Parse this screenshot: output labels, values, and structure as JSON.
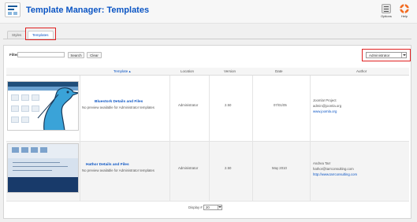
{
  "header": {
    "title": "Template Manager: Templates",
    "toolbar": [
      {
        "label": "Options",
        "icon": "options-icon"
      },
      {
        "label": "Help",
        "icon": "help-icon"
      }
    ]
  },
  "tabs": [
    {
      "label": "Styles",
      "active": false
    },
    {
      "label": "Templates",
      "active": true
    }
  ],
  "filter": {
    "label": "Filter:",
    "value": "",
    "search_label": "Search",
    "clear_label": "Clear",
    "client_select": "Administrator"
  },
  "table": {
    "columns": [
      "Template",
      "Location",
      "Version",
      "Date",
      "Author"
    ],
    "rows": [
      {
        "name": "Bluestork Details and Files",
        "desc": "No preview available for Administrator templates",
        "location": "Administrator",
        "version": "2.50",
        "date": "07/01/05",
        "author_name": "Joomla! Project",
        "author_email": "admin@joomla.org",
        "author_url": "www.joomla.org"
      },
      {
        "name": "Hathor Details and Files",
        "desc": "No preview available for Administrator templates",
        "location": "Administrator",
        "version": "2.50",
        "date": "May 2010",
        "author_name": "Andrea Tarr",
        "author_email": "hathor@tarrconsulting.com",
        "author_url": "http://www.tarrconsulting.com"
      }
    ]
  },
  "footer": {
    "display_label": "Display #",
    "display_value": "20"
  },
  "colors": {
    "title_blue": "#0b55c4",
    "highlight_red": "#e02020",
    "help_orange": "#f26b21"
  }
}
